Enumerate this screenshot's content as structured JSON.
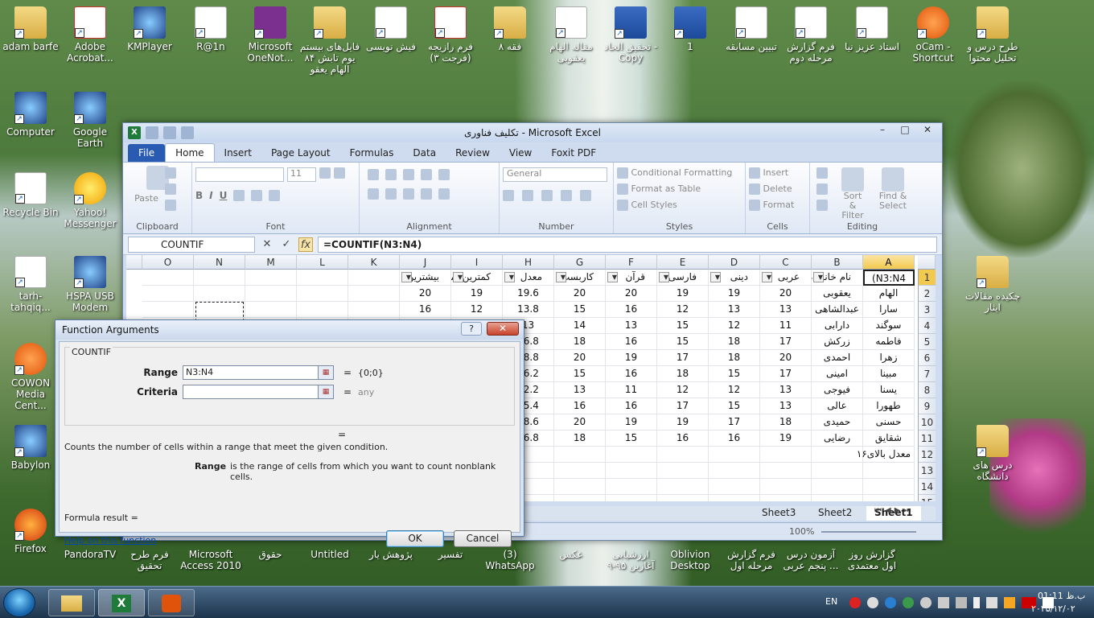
{
  "desktop": {
    "icons_top": [
      {
        "label": "adam barfe",
        "type": "folder"
      },
      {
        "label": "Adobe Acrobat...",
        "type": "pdf"
      },
      {
        "label": "KMPlayer",
        "type": "app"
      },
      {
        "label": "R@1n",
        "type": "doc"
      },
      {
        "label": "Microsoft OneNot...",
        "type": "purple"
      },
      {
        "label": "فایل‌های بیستم یوم تابش ۸۴ الهام یعقو",
        "type": "folder"
      },
      {
        "label": "فیش نویسی",
        "type": "doc"
      },
      {
        "label": "فرم رازیجه (فرجت ۳)",
        "type": "pdf"
      },
      {
        "label": "فقه ۸",
        "type": "folder"
      },
      {
        "label": "مقاله الهام یعقوبی",
        "type": "doc"
      },
      {
        "label": "تحقیق الحاد - Copy",
        "type": "word"
      },
      {
        "label": "1",
        "type": "word"
      },
      {
        "label": "تبیین مسابقه",
        "type": "doc"
      },
      {
        "label": "فرم گزارش مرحله دوم",
        "type": "doc"
      },
      {
        "label": "استاد عزیز نیا",
        "type": "doc"
      },
      {
        "label": "oCam - Shortcut",
        "type": "orange"
      },
      {
        "label": "طرح درس و تحلیل محتوا",
        "type": "folder"
      }
    ],
    "icons_left": [
      {
        "label": "Computer",
        "type": "app"
      },
      {
        "label": "Google Earth",
        "type": "app"
      },
      {
        "label": "Recycle Bin",
        "type": "doc"
      },
      {
        "label": "Yahoo! Messenger",
        "type": "yellow"
      },
      {
        "label": "tarh-tahqiq...",
        "type": "doc"
      },
      {
        "label": "HSPA USB Modem",
        "type": "app"
      },
      {
        "label": "COWON Media Cent...",
        "type": "orange"
      },
      {
        "label": "Babylon",
        "type": "app"
      },
      {
        "label": "Firefox",
        "type": "fox"
      }
    ],
    "icons_right": [
      {
        "label": "چکیده مقالات ایثار",
        "type": "folder"
      },
      {
        "label": "درس های دانشگاه",
        "type": "folder"
      }
    ],
    "icons_bottom": [
      {
        "label": "PandoraTV"
      },
      {
        "label": "فرم طرح تحقیق"
      },
      {
        "label": "Microsoft Access 2010"
      },
      {
        "label": "حقوق"
      },
      {
        "label": "Untitled"
      },
      {
        "label": "پژوهش یار"
      },
      {
        "label": "تفسیر"
      },
      {
        "label": "(3) WhatsApp"
      },
      {
        "label": "عکس"
      },
      {
        "label": "ارزشیابی آغازین ۹۵-۹"
      },
      {
        "label": "Oblivion Desktop"
      },
      {
        "label": "فرم گزارش مرحله اول"
      },
      {
        "label": "آزمون درس پنجم عربی ..."
      },
      {
        "label": "گزارش روز اول معتمدی"
      }
    ]
  },
  "excel": {
    "title": "تکلیف فناوری  -  Microsoft Excel",
    "tabs": [
      "File",
      "Home",
      "Insert",
      "Page Layout",
      "Formulas",
      "Data",
      "Review",
      "View",
      "Foxit PDF"
    ],
    "active_tab": "Home",
    "ribbon": {
      "clipboard": {
        "label": "Clipboard",
        "paste": "Paste"
      },
      "font": {
        "label": "Font",
        "size": "11"
      },
      "alignment": {
        "label": "Alignment"
      },
      "number": {
        "label": "Number",
        "format": "General"
      },
      "styles": {
        "label": "Styles",
        "conditional": "Conditional Formatting",
        "table": "Format as Table",
        "cell": "Cell Styles"
      },
      "cells": {
        "label": "Cells",
        "insert": "Insert",
        "delete": "Delete",
        "format": "Format"
      },
      "editing": {
        "label": "Editing",
        "sort": "Sort & Filter",
        "find": "Find & Select"
      }
    },
    "namebox": "COUNTIF",
    "formula": "=COUNTIF(N3:N4)",
    "columns": [
      "O",
      "N",
      "M",
      "L",
      "K",
      "J",
      "I",
      "H",
      "G",
      "F",
      "E",
      "D",
      "C",
      "B",
      "A"
    ],
    "rows": [
      "1",
      "2",
      "3",
      "4",
      "5",
      "6",
      "7",
      "8",
      "9",
      "10",
      "11",
      "12",
      "13",
      "14",
      "15"
    ],
    "headers": {
      "A": "N3:N4)",
      "B": "نام خانواده",
      "C": "عربی",
      "D": "دینی",
      "E": "فارسی",
      "F": "قرآن",
      "G": "کاربست",
      "H": "معدل",
      "I": "کمترین نمره",
      "J": "بیشترین"
    },
    "table": [
      {
        "B": "الهام",
        "C": "یعقوبی",
        "D": "20",
        "E": "19",
        "F": "19",
        "G": "20",
        "H": "20",
        "I": "19.6",
        "J": "19",
        "K": "20"
      },
      {
        "B": "سارا",
        "C": "عبدالشاهی",
        "D": "13",
        "E": "13",
        "F": "12",
        "G": "16",
        "H": "15",
        "I": "13.8",
        "J": "12",
        "K": "16"
      },
      {
        "B": "سوگند",
        "C": "دارابی",
        "D": "11",
        "E": "12",
        "F": "15",
        "G": "13",
        "H": "14",
        "I": "13",
        "J": "",
        "K": ""
      },
      {
        "B": "فاطمه",
        "C": "زرکش",
        "D": "17",
        "E": "18",
        "F": "15",
        "G": "16",
        "H": "18",
        "I": "16.8",
        "J": "",
        "K": ""
      },
      {
        "B": "زهرا",
        "C": "احمدی",
        "D": "20",
        "E": "18",
        "F": "17",
        "G": "19",
        "H": "20",
        "I": "18.8",
        "J": "",
        "K": ""
      },
      {
        "B": "مبینا",
        "C": "امینی",
        "D": "17",
        "E": "15",
        "F": "18",
        "G": "16",
        "H": "15",
        "I": "16.2",
        "J": "",
        "K": ""
      },
      {
        "B": "یسنا",
        "C": "فیوجی",
        "D": "13",
        "E": "12",
        "F": "12",
        "G": "11",
        "H": "13",
        "I": "12.2",
        "J": "",
        "K": ""
      },
      {
        "B": "طهورا",
        "C": "عالی",
        "D": "13",
        "E": "15",
        "F": "17",
        "G": "16",
        "H": "16",
        "I": "15.4",
        "J": "",
        "K": ""
      },
      {
        "B": "حسنی",
        "C": "حمیدی",
        "D": "18",
        "E": "17",
        "F": "19",
        "G": "19",
        "H": "20",
        "I": "18.6",
        "J": "",
        "K": ""
      },
      {
        "B": "شقایق",
        "C": "رضایی",
        "D": "19",
        "E": "16",
        "F": "16",
        "G": "15",
        "H": "18",
        "I": "16.8",
        "J": "",
        "K": ""
      }
    ],
    "row12_note": "معدل بالای۱۶",
    "sheets": [
      "Sheet3",
      "Sheet2",
      "Sheet1"
    ],
    "active_sheet": "Sheet1",
    "zoom": "100%"
  },
  "dialog": {
    "title": "Function Arguments",
    "function": "COUNTIF",
    "range_label": "Range",
    "range_value": "N3:N4",
    "range_result": "{0;0}",
    "criteria_label": "Criteria",
    "criteria_value": "",
    "criteria_result": "any",
    "eq": "=",
    "description": "Counts the number of cells within a range that meet the given condition.",
    "arg_name": "Range",
    "arg_desc": "is the range of cells from which you want to count nonblank cells.",
    "formula_result": "Formula result =",
    "help": "Help on this function",
    "ok": "OK",
    "cancel": "Cancel"
  },
  "taskbar": {
    "lang": "EN",
    "time": "01:11 ب.ظ",
    "date": "۲۰۲۵/۱۲/۰۲"
  },
  "colors": {
    "accent": "#2a5bb2",
    "excel_green": "#1f7b3a",
    "selection": "#f2c94f"
  }
}
